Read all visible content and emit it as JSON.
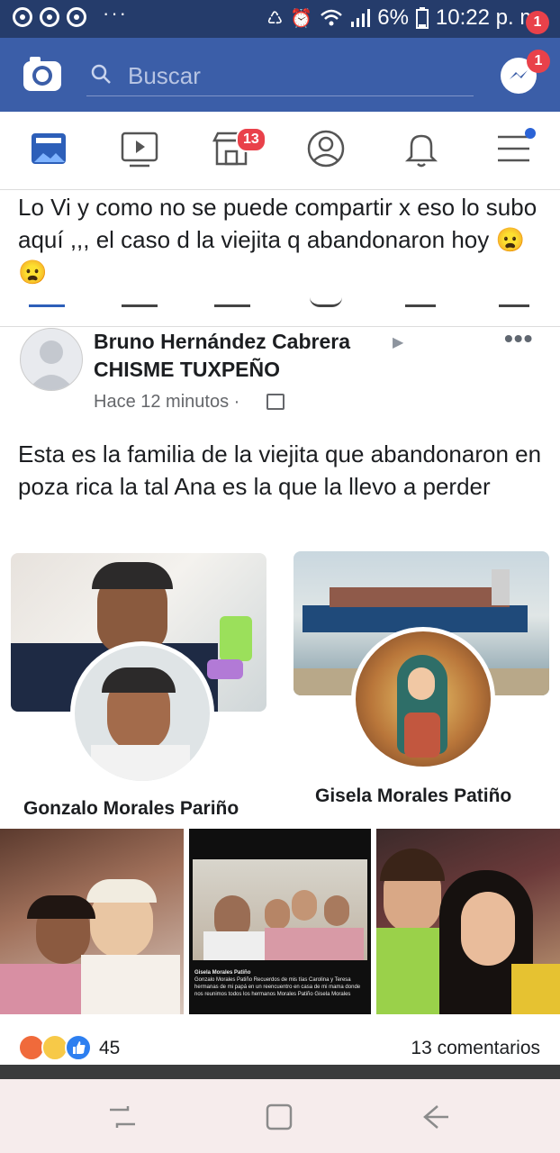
{
  "status_bar": {
    "battery": "6%",
    "time": "10:22 p. m.",
    "more": "···"
  },
  "topbar": {
    "search_placeholder": "Buscar",
    "messenger_badge": "1"
  },
  "nav": {
    "marketplace_badge": "13"
  },
  "shared_caption": "Lo Vi y como no se puede compartir x eso lo subo aquí ,,, el caso d la viejita q abandonaron hoy 😦 😦",
  "post": {
    "author": "Bruno Hernández Cabrera",
    "group": "CHISME TUXPEÑO",
    "time": "Hace 12 minutos ·",
    "more": "•••",
    "text": "Esta es la familia de la viejita que abandonaron en poza rica la tal Ana es la que la llevo a perder",
    "profiles": [
      {
        "name": "Gonzalo Morales Pariño"
      },
      {
        "name": "Gisela Morales Patiño"
      }
    ],
    "screenshot_text": {
      "line1": "Gisela Morales Patiño",
      "line2": "Gonzalo Morales Patiño Recuerdos de mis tías Carolina y Teresa hermanas de mi papá en un reencuentro en casa de mi mama donde nos reunimos todos los hermanos Morales Patiño Gisela Morales"
    },
    "reaction_count": "45",
    "comments": "13 comentarios"
  },
  "colors": {
    "status_bar": "#253c6b",
    "header": "#3b5ea8",
    "badge": "#e9414a"
  }
}
